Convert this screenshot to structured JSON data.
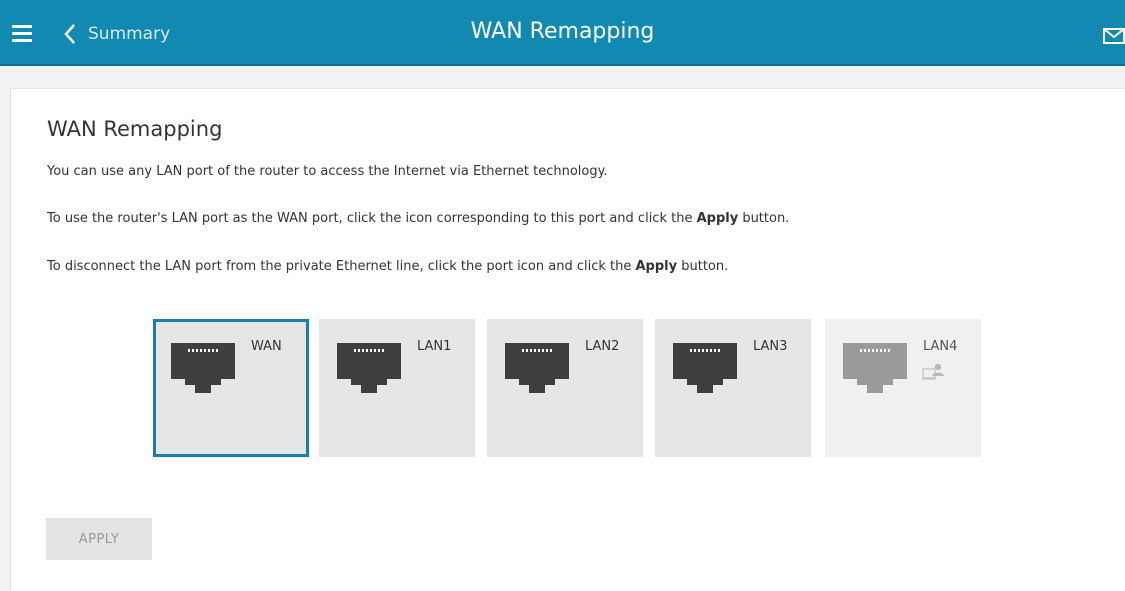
{
  "header": {
    "back_label": "Summary",
    "title": "WAN Remapping",
    "accent_color": "#1189b0"
  },
  "main": {
    "heading": "WAN Remapping",
    "intro": "You can use any LAN port of the router to access the Internet via Ethernet technology.",
    "instruction1_before": "To use the router's LAN port as the WAN port, click the icon corresponding to this port and click the ",
    "instruction1_bold": "Apply",
    "instruction1_after": " button.",
    "instruction2_before": "To disconnect the LAN port from the private Ethernet line, click the port icon and click the ",
    "instruction2_bold": "Apply",
    "instruction2_after": " button.",
    "ports": [
      {
        "label": "WAN",
        "state": "selected",
        "icon": "ethernet-port-icon"
      },
      {
        "label": "LAN1",
        "state": "normal",
        "icon": "ethernet-port-icon"
      },
      {
        "label": "LAN2",
        "state": "normal",
        "icon": "ethernet-port-icon"
      },
      {
        "label": "LAN3",
        "state": "normal",
        "icon": "ethernet-port-icon"
      },
      {
        "label": "LAN4",
        "state": "disabled",
        "icon": "ethernet-port-icon",
        "badge": "client-user-icon"
      }
    ],
    "apply_label": "APPLY",
    "apply_enabled": false
  }
}
